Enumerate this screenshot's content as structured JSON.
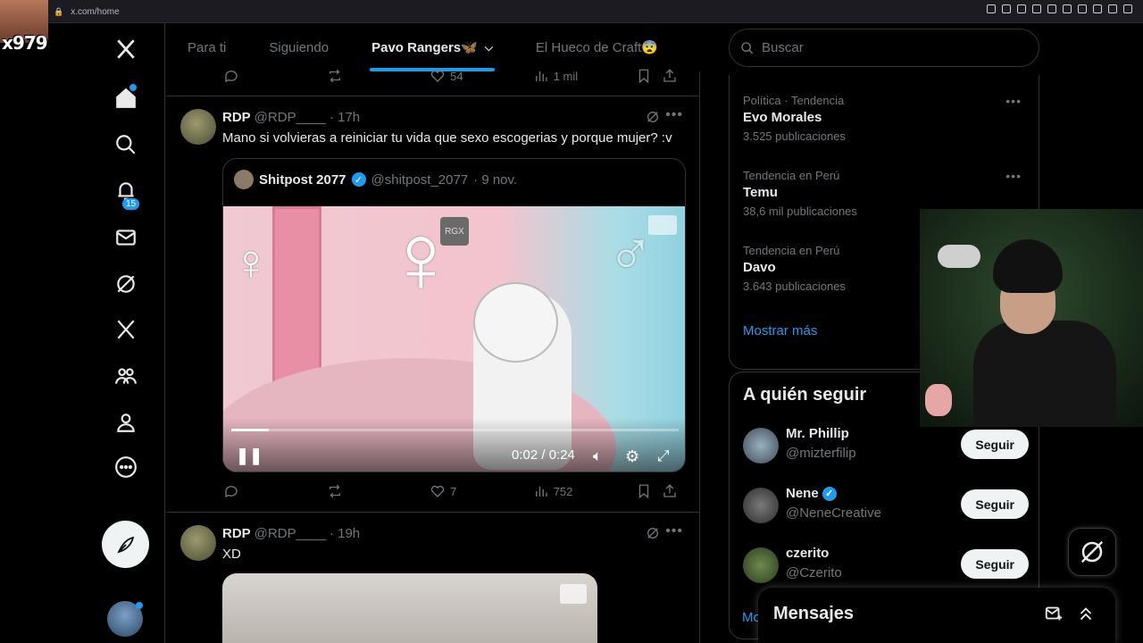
{
  "browser": {
    "url": "x.com/home"
  },
  "overlay": {
    "streamer_name": "x979"
  },
  "nav": {
    "notification_count": "15"
  },
  "tabs": [
    {
      "label": "Para ti"
    },
    {
      "label": "Siguiendo"
    },
    {
      "label": "Pavo Rangers🦋"
    },
    {
      "label": "El Hueco de Craft😨"
    }
  ],
  "prev_post": {
    "likes": "54",
    "views": "1 mil"
  },
  "post1": {
    "name": "RDP",
    "handle": "@RDP____",
    "time": "· 17h",
    "text": "Mano si volvieras a reiniciar tu vida que sexo escogerias y porque mujer? :v",
    "quote": {
      "name": "Shitpost 2077",
      "handle": "@shitpost_2077",
      "time": "· 9 nov.",
      "watermark": "RGX",
      "timecode": "0:02 / 0:24",
      "progress": 0.083
    },
    "likes": "7",
    "views": "752"
  },
  "post2": {
    "name": "RDP",
    "handle": "@RDP____",
    "time": "· 19h",
    "text": "XD"
  },
  "search": {
    "placeholder": "Buscar"
  },
  "trends": [
    {
      "context": "Política · Tendencia",
      "title": "Evo Morales",
      "count": "3.525 publicaciones"
    },
    {
      "context": "Tendencia en Perú",
      "title": "Temu",
      "count": "38,6 mil publicaciones"
    },
    {
      "context": "Tendencia en Perú",
      "title": "Davo",
      "count": "3.643 publicaciones"
    }
  ],
  "show_more": "Mostrar más",
  "who_to_follow": {
    "title": "A quién seguir",
    "users": [
      {
        "name": "Mr. Phillip",
        "handle": "@mizterfilip",
        "button": "Seguir"
      },
      {
        "name": "Nene",
        "handle": "@NeneCreative",
        "button": "Seguir"
      },
      {
        "name": "czerito",
        "handle": "@Czerito",
        "button": "Seguir"
      }
    ],
    "more_peek": "Mo"
  },
  "messages": {
    "title": "Mensajes"
  },
  "colors": {
    "accent": "#1d9bf0",
    "background": "#000000",
    "text": "#e7e9ea",
    "muted": "#71767b"
  }
}
